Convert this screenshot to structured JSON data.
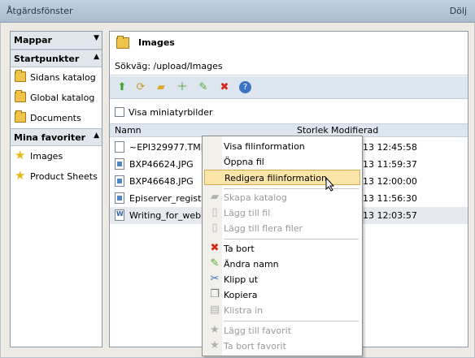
{
  "window": {
    "title": "Åtgärdsfönster",
    "hide_label": "Dölj"
  },
  "sidebar": {
    "sections": [
      {
        "label": "Mappar",
        "chevron": "»"
      },
      {
        "label": "Startpunkter",
        "chevron": "«"
      },
      {
        "label": "Mina favoriter",
        "chevron": "«"
      }
    ],
    "startpoints": [
      {
        "label": "Sidans katalog",
        "icon": "folder-icon"
      },
      {
        "label": "Global katalog",
        "icon": "folder-icon"
      },
      {
        "label": "Documents",
        "icon": "folder-icon"
      }
    ],
    "favorites": [
      {
        "label": "Images",
        "icon": "star-icon"
      },
      {
        "label": "Product Sheets",
        "icon": "star-icon"
      }
    ]
  },
  "main": {
    "title": "Images",
    "path": "Sökväg: /upload/Images",
    "show_thumbnails_label": "Visa miniatyrbilder",
    "columns": {
      "name": "Namn",
      "size": "Storlek",
      "modified": "Modifierad"
    },
    "files": [
      {
        "name": "~EPI329977.TMP",
        "modified": "-13 12:45:58",
        "icon": "file-icon"
      },
      {
        "name": "BXP46624.JPG",
        "modified": "-13 11:59:37",
        "icon": "image-file-icon"
      },
      {
        "name": "BXP46648.JPG",
        "modified": "-13 12:00:00",
        "icon": "image-file-icon"
      },
      {
        "name": "Episerver_registre",
        "modified": "-13 11:56:30",
        "icon": "image-file-icon"
      },
      {
        "name": "Writing_for_web.p",
        "modified": "-13 12:03:57",
        "icon": "word-file-icon"
      }
    ]
  },
  "context_menu": {
    "group1": [
      "Visa filinformation",
      "Öppna fil",
      "Redigera filinformation"
    ],
    "group2": [
      "Skapa katalog",
      "Lägg till fil",
      "Lägg till flera filer"
    ],
    "group3": [
      "Ta bort",
      "Ändra namn",
      "Klipp ut",
      "Kopiera",
      "Klistra in"
    ],
    "group4": [
      "Lägg till favorit",
      "Ta bort favorit"
    ]
  },
  "colors": {
    "accent": "#e6c46a",
    "delete": "#d6261a",
    "toolbar": "#dde5ee"
  }
}
